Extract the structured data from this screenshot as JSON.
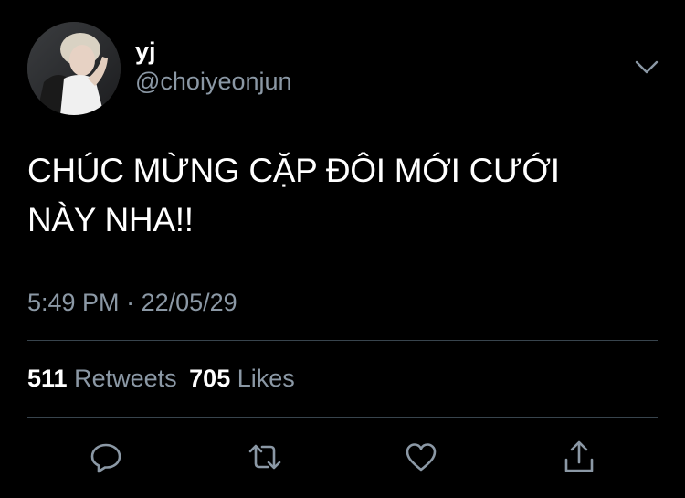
{
  "user": {
    "display_name": "yj",
    "handle": "@choiyeonjun"
  },
  "tweet": {
    "text_line1": "CHÚC MỪNG CẶP ĐÔI MỚI CƯỚI",
    "text_line2": "NÀY NHA!!",
    "time": "5:49 PM",
    "separator": "·",
    "date": "22/05/29"
  },
  "stats": {
    "retweets_count": "511",
    "retweets_label": "Retweets",
    "likes_count": "705",
    "likes_label": "Likes"
  },
  "icons": {
    "caret": "chevron-down-icon",
    "reply": "reply-icon",
    "retweet": "retweet-icon",
    "like": "heart-icon",
    "share": "share-icon"
  },
  "colors": {
    "background": "#000000",
    "text_primary": "#ffffff",
    "text_secondary": "#8b98a5",
    "divider": "#38444d"
  }
}
